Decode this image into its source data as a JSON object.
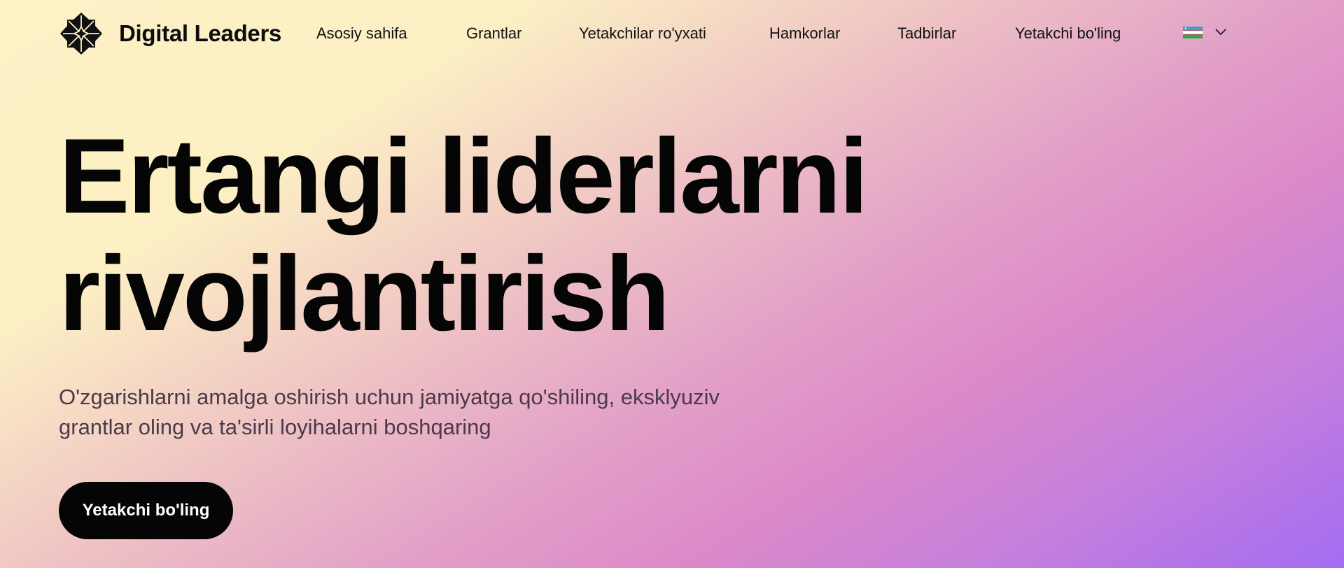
{
  "brand": {
    "name": "Digital Leaders",
    "logo_icon": "star-logo-icon"
  },
  "nav": {
    "items": [
      {
        "label": "Asosiy sahifa"
      },
      {
        "label": "Grantlar"
      },
      {
        "label": "Yetakchilar ro'yxati"
      },
      {
        "label": "Hamkorlar"
      },
      {
        "label": "Tadbirlar"
      },
      {
        "label": "Yetakchi bo'ling"
      }
    ]
  },
  "language": {
    "flag_icon": "uzbekistan-flag-icon",
    "dropdown_icon": "chevron-down-icon"
  },
  "hero": {
    "title_line1": "Ertangi liderlarni",
    "title_line2": "rivojlantirish",
    "subtitle_line1": "O'zgarishlarni amalga oshirish uchun jamiyatga qo'shiling, eksklyuziv",
    "subtitle_line2": "grantlar oling va ta'sirli loyihalarni boshqaring",
    "cta_label": "Yetakchi bo'ling"
  },
  "colors": {
    "gradient_start": "#fdf1c6",
    "gradient_mid": "#dc8ac8",
    "gradient_end": "#a46cf2",
    "cta_background": "#050505",
    "cta_text": "#ffffff",
    "subtitle_text": "#4a3a49"
  }
}
